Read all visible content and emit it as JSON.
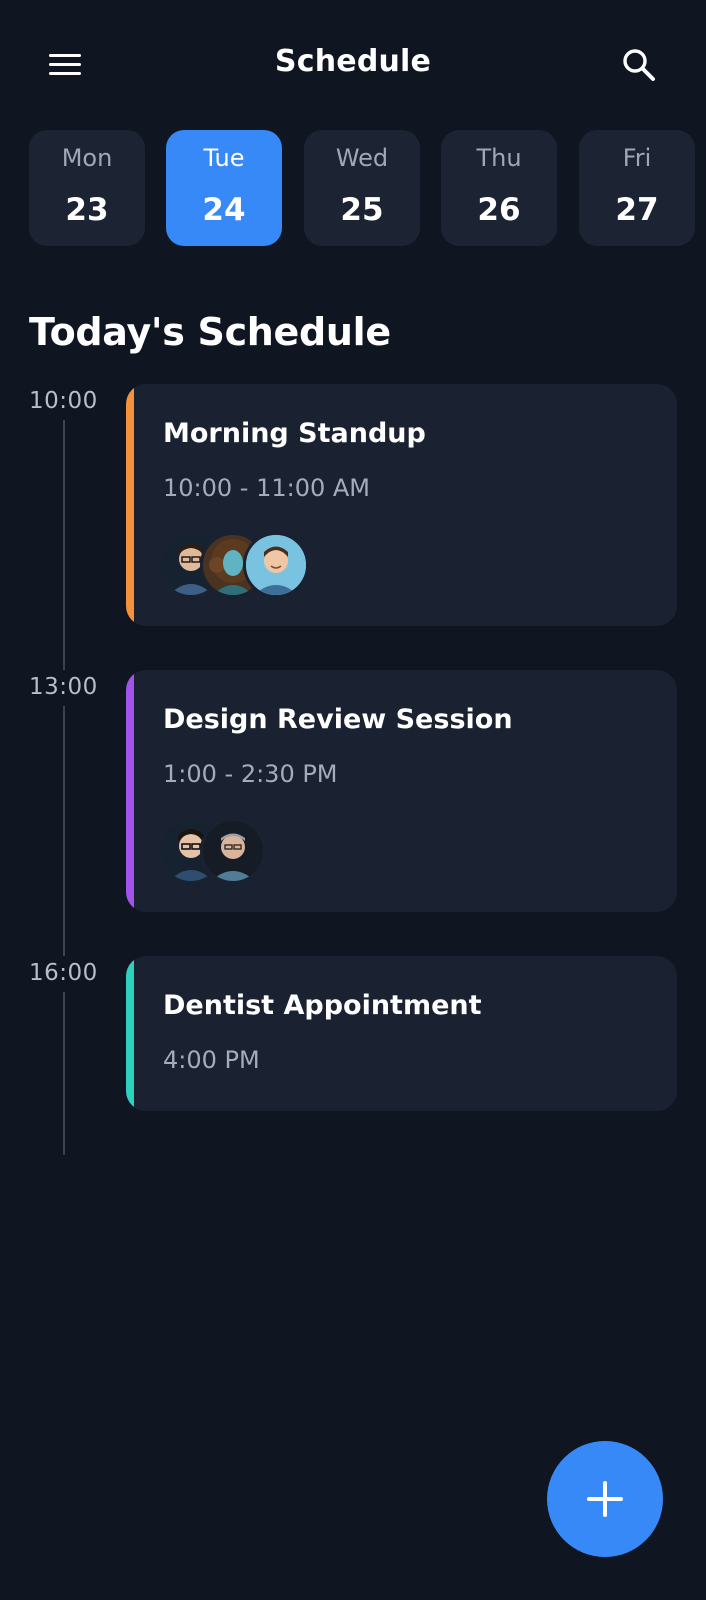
{
  "header": {
    "title": "Schedule",
    "menu_icon": "hamburger-menu-icon",
    "search_icon": "search-icon"
  },
  "days": [
    {
      "name": "Mon",
      "num": "23",
      "selected": false
    },
    {
      "name": "Tue",
      "num": "24",
      "selected": true
    },
    {
      "name": "Wed",
      "num": "25",
      "selected": false
    },
    {
      "name": "Thu",
      "num": "26",
      "selected": false
    },
    {
      "name": "Fri",
      "num": "27",
      "selected": false
    }
  ],
  "section_title": "Today's Schedule",
  "events": [
    {
      "hour": "10:00",
      "title": "Morning Standup",
      "time": "10:00 - 11:00 AM",
      "accent": "#f5913a",
      "attendees": [
        "man-glasses-avatar",
        "woman-curly-hair-avatar",
        "man-smiling-avatar"
      ]
    },
    {
      "hour": "13:00",
      "title": "Design Review Session",
      "time": "1:00 - 2:30 PM",
      "accent": "#a352ea",
      "attendees": [
        "man-glasses-avatar",
        "older-man-avatar"
      ]
    },
    {
      "hour": "16:00",
      "title": "Dentist Appointment",
      "time": "4:00 PM",
      "accent": "#2ed1bd",
      "attendees": []
    }
  ],
  "fab_icon": "plus-icon",
  "colors": {
    "background": "#0f1521",
    "card": "#1a2130",
    "accent_blue": "#3689f6"
  }
}
